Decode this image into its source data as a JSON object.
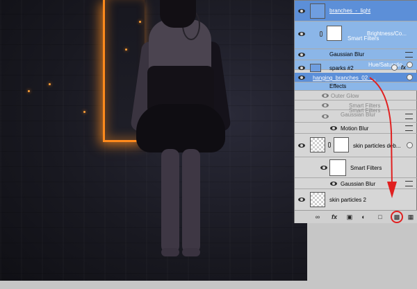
{
  "layers": {
    "rows": [
      {
        "name": "branches_-_light",
        "state": "selected"
      },
      {
        "name": "Brightness/Co...",
        "state": "selected"
      },
      {
        "name": "Smart Filters",
        "state": "selected"
      },
      {
        "name": "Gaussian Blur",
        "state": "selected"
      },
      {
        "name": "Hue/Saturatio...",
        "state": "selected"
      },
      {
        "name": "sparks #2",
        "state": "selected"
      },
      {
        "name": "hanging_branches_02_...",
        "state": "selected"
      },
      {
        "name": "Effects",
        "state": "selected"
      },
      {
        "name": "Outer Glow",
        "state": "dim"
      },
      {
        "name": "Smart Filters",
        "state": "dim"
      },
      {
        "name": "Gaussian Blur",
        "state": "dim"
      },
      {
        "name": "Smart Filters",
        "state": "dim"
      },
      {
        "name": "Motion Blur",
        "state": "normal"
      },
      {
        "name": "skin particles deb...",
        "state": "normal"
      },
      {
        "name": "Smart Filters",
        "state": "normal"
      },
      {
        "name": "Gaussian Blur",
        "state": "normal"
      },
      {
        "name": "skin particles 2",
        "state": "normal"
      }
    ],
    "bottom_bar": {
      "link": "link-icon",
      "fx": "fx",
      "mask": "mask-icon",
      "adjustment": "adjustment-icon",
      "group": "folder-icon",
      "new_layer": "new-layer-icon",
      "delete": "trash-icon"
    }
  },
  "colors": {
    "selection": "#8bb6e8",
    "selection_dark": "#5c8fd8",
    "annotation": "#e02020",
    "glow": "#ff8a1c"
  }
}
